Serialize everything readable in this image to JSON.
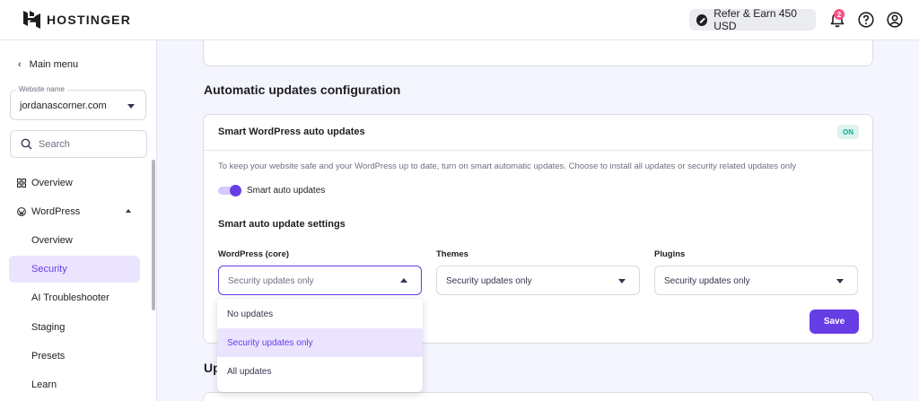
{
  "brand": {
    "name": "HOSTINGER",
    "accent": "#673de6"
  },
  "topbar": {
    "refer_label": "Refer & Earn 450 USD",
    "notification_count": "2",
    "icons": [
      "bell-icon",
      "help-icon",
      "user-icon"
    ]
  },
  "sidebar": {
    "back_label": "Main menu",
    "website": {
      "label": "Website name",
      "value": "jordanascorner.com"
    },
    "search_placeholder": "Search",
    "items": [
      {
        "label": "Overview",
        "icon": "grid-icon"
      },
      {
        "label": "WordPress",
        "icon": "wordpress-icon"
      },
      {
        "label": "Overview"
      },
      {
        "label": "Security",
        "active": true
      },
      {
        "label": "AI Troubleshooter"
      },
      {
        "label": "Staging"
      },
      {
        "label": "Presets"
      },
      {
        "label": "Learn"
      }
    ]
  },
  "main": {
    "section_title": "Automatic updates configuration",
    "card": {
      "title": "Smart WordPress auto updates",
      "status": "ON",
      "description": "To keep your website safe and your WordPress up to date, turn on smart automatic updates. Choose to install all updates or security related updates only",
      "toggle_label": "Smart auto updates",
      "toggle_on": true,
      "settings_title": "Smart auto update settings",
      "fields": [
        {
          "label": "WordPress (core)",
          "value": "Security updates only"
        },
        {
          "label": "Themes",
          "value": "Security updates only"
        },
        {
          "label": "Plugins",
          "value": "Security updates only"
        }
      ],
      "save_label": "Save"
    },
    "dropdown_options": [
      {
        "label": "No updates"
      },
      {
        "label": "Security updates only",
        "selected": true
      },
      {
        "label": "All updates"
      }
    ],
    "next_section_title": "Up"
  }
}
